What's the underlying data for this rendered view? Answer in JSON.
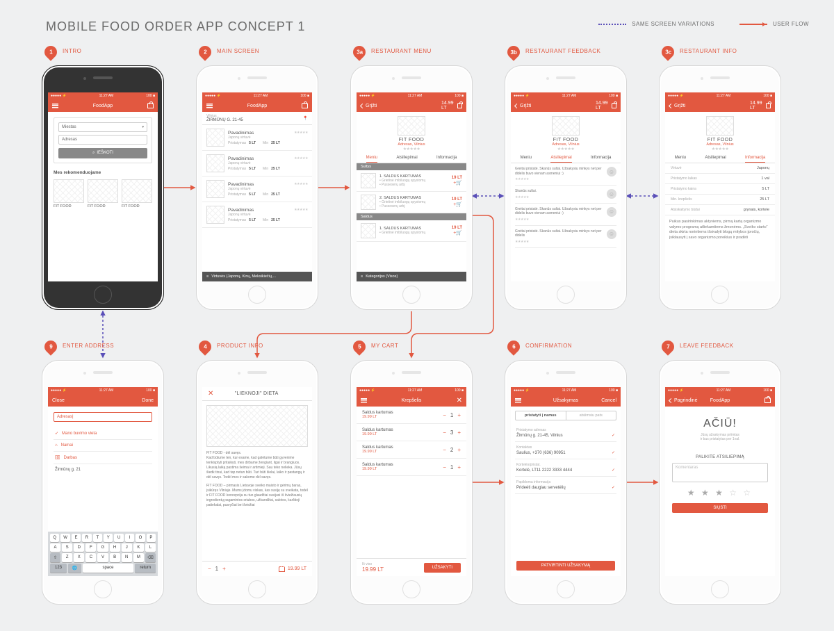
{
  "title": "MOBILE FOOD ORDER APP CONCEPT 1",
  "legend": {
    "variations": "SAME SCREEN VARIATIONS",
    "flow": "USER FLOW"
  },
  "status": {
    "time": "11:27 AM",
    "carrier": "●●●●●  ⚡",
    "batt": "100 ■"
  },
  "steps": [
    {
      "num": "1",
      "label": "INTRO"
    },
    {
      "num": "2",
      "label": "MAIN SCREEN"
    },
    {
      "num": "3a",
      "label": "RESTAURANT MENU"
    },
    {
      "num": "3b",
      "label": "RESTAURANT FEEDBACK"
    },
    {
      "num": "3c",
      "label": "RESTAURANT INFO"
    },
    {
      "num": "9",
      "label": "ENTER ADDRESS"
    },
    {
      "num": "4",
      "label": "PRODUCT INFO"
    },
    {
      "num": "5",
      "label": "MY CART"
    },
    {
      "num": "6",
      "label": "CONFIRMATION"
    },
    {
      "num": "7",
      "label": "LEAVE FEEDBACK"
    }
  ],
  "s1": {
    "app": "FoodApp",
    "city": "Miestas",
    "addr": "Adresas",
    "search": "IEŠKOTI",
    "rec": "Mes rekomenduojame",
    "cards": [
      "FIT FOOD",
      "FIT FOOD",
      "FIT FOOD"
    ]
  },
  "s2": {
    "app": "FoodApp",
    "loc_city": "Vilnius",
    "loc_addr": "ŽIRMŪNŲ G. 21-45",
    "items": [
      {
        "name": "Pavadinimas",
        "sub": "Japonų virtuvė",
        "d": "Pristatymas",
        "dv": "5 LT",
        "m": "Min",
        "mv": "25 LT"
      },
      {
        "name": "Pavadinimas",
        "sub": "Japonų virtuvė",
        "d": "Pristatymas",
        "dv": "5 LT",
        "m": "Min",
        "mv": "25 LT"
      },
      {
        "name": "Pavadinimas",
        "sub": "Japonų virtuvė",
        "d": "Pristatymas",
        "dv": "5 LT",
        "m": "Min",
        "mv": "25 LT"
      },
      {
        "name": "Pavadinimas",
        "sub": "Japonų virtuvė",
        "d": "Pristatymas",
        "dv": "5 LT",
        "m": "Min",
        "mv": "25 LT"
      }
    ],
    "filter": "Virtuvės (Japonų, Kinų, Meksikiečių,..."
  },
  "s3": {
    "back": "Grįžti",
    "total": "14.99 LT",
    "rest": "FIT FOOD",
    "addr": "Adresas, Vilnius",
    "tabs": [
      "Meniu",
      "Atsiliepimai",
      "Informacija"
    ],
    "cat1": "Sultys",
    "cat2": "Saldus",
    "menu": [
      {
        "n": "1. SALDUS KARTUMAS",
        "d": "• Grietinė imbiluogų spystomų",
        "d2": "• Pusseserų arbj",
        "p": "19 LT"
      },
      {
        "n": "2. SALDUS KARTUMAS",
        "d": "• Grietinė imbiluogų spystomų",
        "d2": "• Pusseserų arbj",
        "p": "19 LT"
      },
      {
        "n": "1. SALDUS KARTUMAS",
        "d": "• Grietinė imbiluogų spystomų",
        "d2": "",
        "p": "19 LT"
      }
    ],
    "footer": "Kategorijos (Visos)"
  },
  "s3b": {
    "back": "Grįžti",
    "total": "14.99 LT",
    "rest": "FIT FOOD",
    "addr": "Adresas, Vilnius",
    "tabs": [
      "Meniu",
      "Atsiliepimai",
      "Informacija"
    ],
    "fb": [
      "Greitai pristatė. Skanūs sultai. Užsakysiu minkys net per didelis buvo vienam asmeniui :)",
      "Skanūs sultai.",
      "Greitai pristatė. Skanūs sultai. Užsakysiu minkys net per didelis buvo vienam asmeniui :)",
      "Greitai pristatė. Skanūs sultai. Užsakysiu minkys net per didelis"
    ]
  },
  "s3c": {
    "back": "Grįžti",
    "total": "14.99 LT",
    "rest": "FIT FOOD",
    "addr": "Adresas, Vilnius",
    "tabs": [
      "Meniu",
      "Atsiliepimai",
      "Informacija"
    ],
    "rows": [
      [
        "Virtuvė",
        "Japonų"
      ],
      [
        "Pristatymo laikas",
        "1 val"
      ],
      [
        "Pristatymo kaina",
        "5 LT"
      ],
      [
        "Min. krepšelis",
        "25 LT"
      ],
      [
        "Atsiskaitymo būdai",
        "grynais, kortele"
      ]
    ],
    "desc": "Puikus pasirinkimas aktyviems, pirmą kartą organizmo valymo programą atliekamtiems žmonėms. „Sveiko starto“ dieta skirta norintiems išsivalyti blogų mitybos įpročių, įsiklausyti į savo organizmo poreikius ir pradėti"
  },
  "s9": {
    "close": "Close",
    "done": "Done",
    "addr": "Adresas|",
    "opt1": "Mano buvimo vieta",
    "opt2": "Namai",
    "opt3": "Darbas",
    "val": "Žirmūnų g. 21",
    "keys": [
      [
        "Q",
        "W",
        "E",
        "R",
        "T",
        "Y",
        "U",
        "I",
        "O",
        "P"
      ],
      [
        "A",
        "S",
        "D",
        "F",
        "G",
        "H",
        "J",
        "K",
        "L"
      ],
      [
        "⇧",
        "Z",
        "X",
        "C",
        "V",
        "B",
        "N",
        "M",
        "⌫"
      ]
    ]
  },
  "s4": {
    "title": "\"LIEKNOJI\" DIETA",
    "p1": "FIT FOOD - dėl savęs.\nKad būtume ten, kur esame, kad galėtume būti gyvenime tenkisptyti pritaikyti, mes dirbame žengiant, ligai ir brangiuos. Likusią laiką pastima šeima ir artimieji. Sau teko nelieka. Jūsų šiedk tinui, kad tap netun būti. Turi būti šielai, laiko ir pastangų ir dėl savęs. Todėl mes ir sakome dėl savęs.",
    "p2": "FIT FOOD – pirmasis Lietuvoje sveiko maisto ir gėrimų baras, įsikūręs Vilniuje. Mums įdomu viskas, kas susiję su sveikata, todėl ir FIT FOOD koncepcija su tuo glaudžiai susijusi iš šviežiausių ingredientų pagamintos sriubos, užkandžiai, salotos, karštieji patiekalai, pusryčiai bei šviežiai",
    "qty": "1",
    "price": "19.99 LT"
  },
  "s5": {
    "title": "Krepšelis",
    "items": [
      {
        "n": "Saldus kartumas",
        "p": "19.99 LT",
        "q": "1"
      },
      {
        "n": "Saldus kartumas",
        "p": "19.99 LT",
        "q": "3"
      },
      {
        "n": "Saldus kartumas",
        "p": "19.99 LT",
        "q": "2"
      },
      {
        "n": "Saldus kartumas",
        "p": "19.99 LT",
        "q": "1"
      }
    ],
    "total_label": "Iš viso",
    "total": "19.99 LT",
    "order": "UŽSAKYTI"
  },
  "s6": {
    "title": "Užsakymas",
    "cancel": "Cancel",
    "seg": [
      "pristatyti į namus",
      "atsiimsiu pats"
    ],
    "rows": [
      [
        "Pristatymo adresas",
        "Žirmūnų g. 21-45, Vilnius"
      ],
      [
        "Kontaktas",
        "Saulius, +370 (636) 90951"
      ],
      [
        "Kortelės/pristat.",
        "Kortelė, LT11 2222 3333 4444"
      ],
      [
        "Papildoma informacija",
        "Prideėti daugiau servetėlių"
      ]
    ],
    "confirm": "PATVIRTINTI UŽSAKYMĄ"
  },
  "s7": {
    "back": "Pagrindinė",
    "app": "FoodApp",
    "thanks": "AČIŪ!",
    "sub1": "Jūsų užsakymas priimtas",
    "sub2": "ir bus pristatytas per 1val.",
    "leave": "PALIKITE ATSILIEPIMĄ",
    "ph": "Komentaras",
    "send": "SIŲSTI"
  }
}
